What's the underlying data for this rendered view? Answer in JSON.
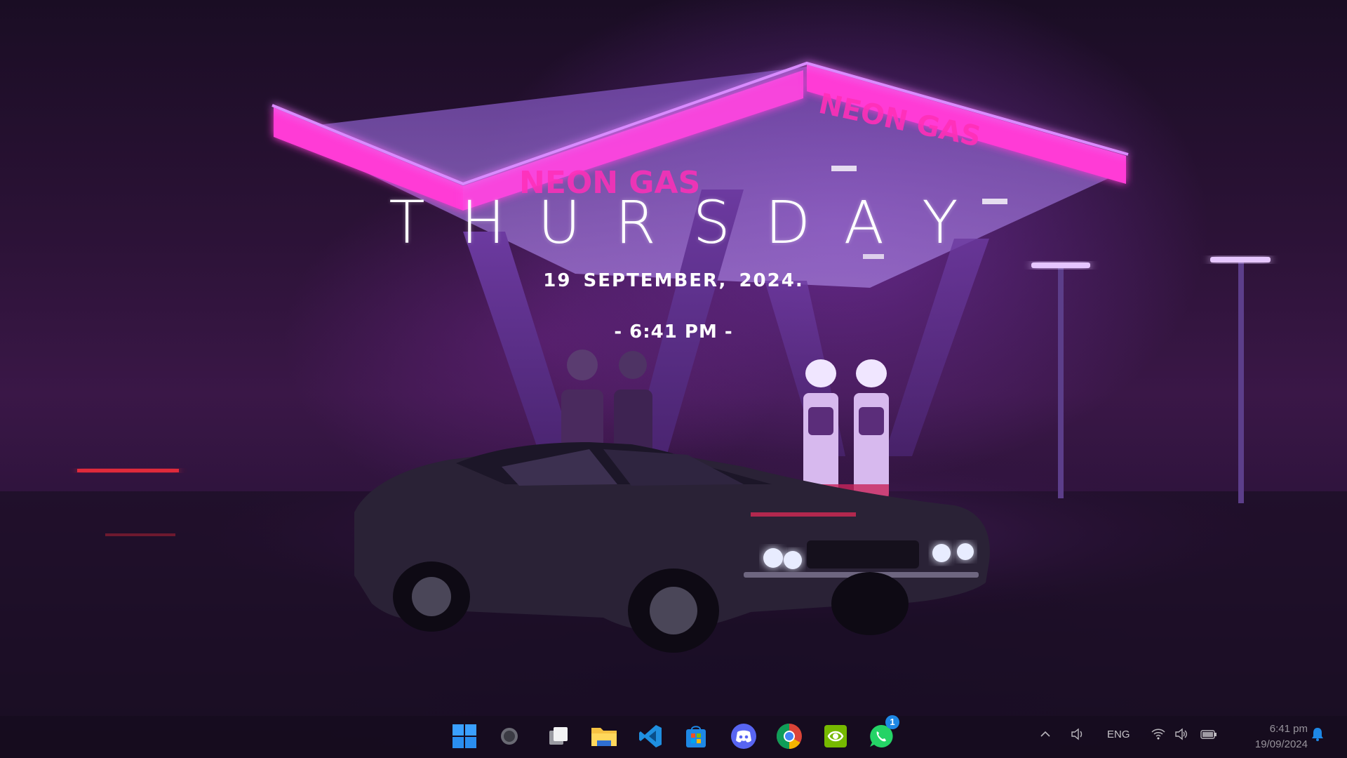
{
  "widget": {
    "day": "THURSDAY",
    "date": "19 SEPTEMBER, 2024.",
    "time": "- 6:41 PM -"
  },
  "wallpaper": {
    "sign_text_left": "NEON GAS",
    "sign_text_right": "NEON GAS"
  },
  "taskbar": {
    "pinned": [
      {
        "name": "start",
        "icon": "windows-logo-icon"
      },
      {
        "name": "search",
        "icon": "circle-search-icon"
      },
      {
        "name": "task-view",
        "icon": "task-view-icon"
      },
      {
        "name": "file-explorer",
        "icon": "folder-icon"
      },
      {
        "name": "vscode",
        "icon": "vscode-icon"
      },
      {
        "name": "microsoft-store",
        "icon": "store-icon"
      },
      {
        "name": "discord",
        "icon": "discord-icon"
      },
      {
        "name": "chrome",
        "icon": "chrome-icon"
      },
      {
        "name": "nvidia",
        "icon": "nvidia-icon"
      },
      {
        "name": "whatsapp",
        "icon": "whatsapp-icon"
      }
    ],
    "whatsapp_badge": "1",
    "tray": {
      "language": "ENG",
      "icons": [
        "chevron-up-icon",
        "speaker-icon",
        "wifi-icon",
        "volume-icon",
        "battery-icon",
        "bell-icon"
      ]
    },
    "clock": {
      "time": "6:41 pm",
      "date": "19/09/2024"
    }
  },
  "colors": {
    "neon_magenta": "#ff3ad6",
    "neon_violet": "#b04cff",
    "badge_blue": "#1e88e5"
  }
}
